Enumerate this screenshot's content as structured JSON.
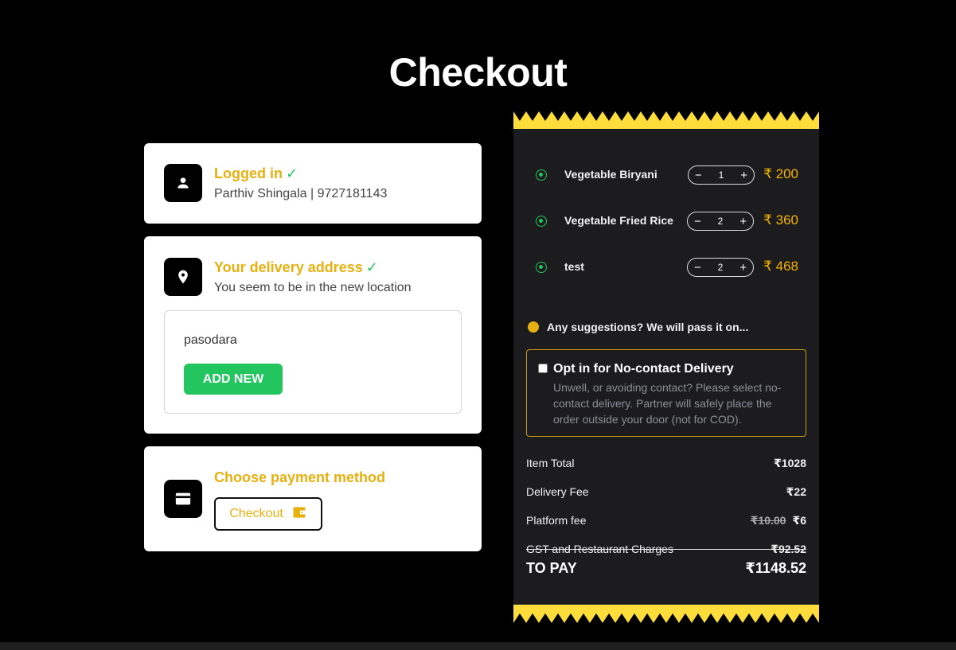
{
  "page": {
    "title": "Checkout"
  },
  "login": {
    "title": "Logged in",
    "check": "✓",
    "user": "Parthiv Shingala | 9727181143",
    "icon": "user-icon"
  },
  "address": {
    "title": "Your delivery address",
    "check": "✓",
    "subtitle": "You seem to be in the new location",
    "saved_address": "pasodara",
    "add_new_label": "ADD NEW",
    "icon": "location-pin-icon"
  },
  "payment": {
    "title": "Choose payment method",
    "button_label": "Checkout",
    "icon": "credit-card-icon",
    "button_icon": "wallet-icon"
  },
  "cart": {
    "items": [
      {
        "name": "Vegetable Biryani",
        "qty": "1",
        "price": "₹ 200"
      },
      {
        "name": "Vegetable Fried Rice",
        "qty": "2",
        "price": "₹ 360"
      },
      {
        "name": "test",
        "qty": "2",
        "price": "₹ 468"
      }
    ],
    "minus": "−",
    "plus": "+",
    "suggestions": "Any suggestions? We will pass it on...",
    "no_contact": {
      "title": "Opt in for No-contact Delivery",
      "description": "Unwell, or avoiding contact? Please select no-contact delivery. Partner will safely place the order outside your door (not for COD)."
    },
    "bill": {
      "item_total_label": "Item Total",
      "item_total": "₹1028",
      "delivery_label": "Delivery Fee",
      "delivery": "₹22",
      "platform_label": "Platform fee",
      "platform_original": "₹10.00",
      "platform": "₹6",
      "gst_label": "GST and Restaurant Charges",
      "gst": "₹92.52",
      "to_pay_label": "TO PAY",
      "to_pay": "₹1148.52"
    }
  },
  "colors": {
    "accent": "#e6b010",
    "success": "#22c55e",
    "receipt_bg": "#1c1c1e",
    "zigzag": "#fddd3c"
  }
}
